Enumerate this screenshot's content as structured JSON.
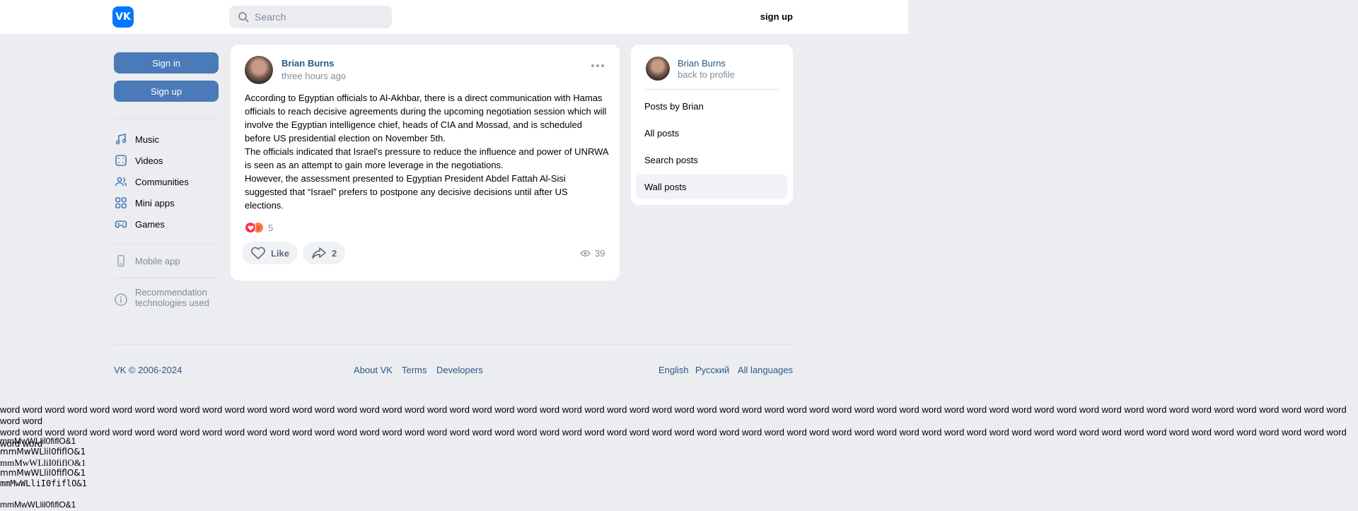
{
  "header": {
    "logo_text": "VK",
    "search_placeholder": "Search",
    "signup_label": "sign up"
  },
  "sidebar": {
    "sign_in_label": "Sign in",
    "sign_up_label": "Sign up",
    "items": [
      {
        "label": "Music",
        "icon": "music-note-icon"
      },
      {
        "label": "Videos",
        "icon": "video-icon"
      },
      {
        "label": "Communities",
        "icon": "people-icon"
      },
      {
        "label": "Mini apps",
        "icon": "grid-icon"
      },
      {
        "label": "Games",
        "icon": "gamepad-icon"
      }
    ],
    "mobile_app_label": "Mobile app",
    "recommendation_line1": "Recommendation",
    "recommendation_line2": "technologies used"
  },
  "post": {
    "author": "Brian Burns",
    "time": "three hours ago",
    "paragraphs": [
      "According to Egyptian officials to Al-Akhbar, there is a direct communication with Hamas officials to reach decisive agreements during the upcoming negotiation session which will involve the Egyptian intelligence chief, heads of CIA and Mossad, and is scheduled before US presidential election on November 5th.",
      "The officials indicated that Israel's pressure to reduce the influence and power of UNRWA is seen as an attempt to gain more leverage in the negotiations.",
      "However, the assessment presented to Egyptian President Abdel Fattah Al-Sisi suggested that “Israel” prefers to postpone any decisive decisions until after US elections."
    ],
    "reactions_count": "5",
    "like_label": "Like",
    "share_count": "2",
    "views_count": "39"
  },
  "profile_card": {
    "name": "Brian Burns",
    "back_label": "back to profile",
    "links": [
      "Posts by Brian",
      "All posts",
      "Search posts",
      "Wall posts"
    ]
  },
  "footer": {
    "copyright": "VK © 2006-2024",
    "about": "About VK",
    "terms": "Terms",
    "developers": "Developers",
    "english": "English",
    "russian": "Русский",
    "all_languages": "All languages"
  },
  "samples": {
    "words_line1": "word word word word word word word word word word word word word word word word word word word word word word word word word word word word word word word word word word word word word word word word word word word word word word word word word word word word word word word word word word word word word word",
    "words_line2": "word word word word word word word word word word word word word word word word word word word word word word word word word word word word word word word word word word word word word word word word word word word word word word word word word word word word word word word word word word word word word word",
    "font_rows": [
      "mmMwWLlil0fiflO&1",
      "mmMwWLlil0fiflO&1",
      "mmMwWLliI0fiflO&1",
      "mmMwWLlil0fiflO&1",
      "mmMwWLliI0fiflO&1",
      "mmMwWLlil0fiflO&1"
    ]
  },
  "colors": {
    "background": "#ebedf0",
    "brand": "#0077ff",
    "button_blue": "#4a7ab7",
    "link": "#2a5885",
    "muted": "#818c99"
  }
}
